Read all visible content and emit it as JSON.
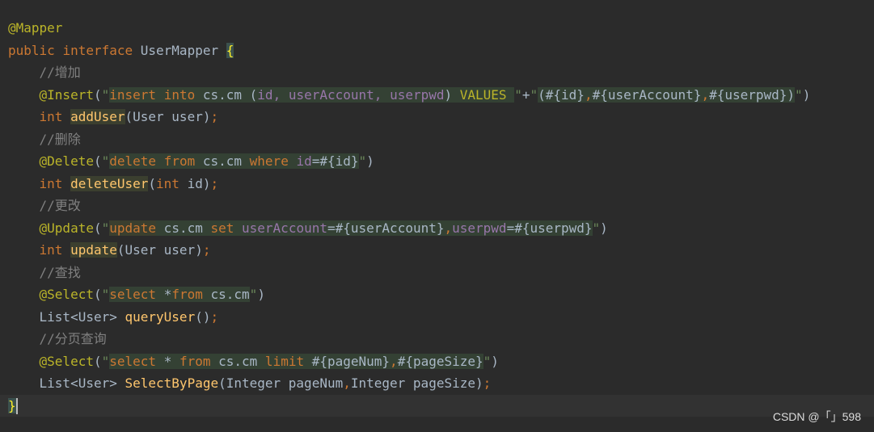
{
  "colors": {
    "background": "#2b2b2b",
    "annotation": "#bbb529",
    "keyword": "#cc7832",
    "string": "#6a8759",
    "sql_keyword": "#cc7832",
    "sql_column": "#9876aa",
    "method": "#ffc66d",
    "comment": "#808080",
    "default": "#a9b7c6"
  },
  "lines": [
    [
      {
        "t": "@Mapper",
        "c": "annotation"
      }
    ],
    [
      {
        "t": "public ",
        "c": "keyword"
      },
      {
        "t": "interface ",
        "c": "keyword"
      },
      {
        "t": "UserMapper ",
        "c": "default"
      },
      {
        "t": "{",
        "c": "brace"
      }
    ],
    [
      {
        "t": "    //增加",
        "c": "comment"
      }
    ],
    [
      {
        "t": "    ",
        "c": "default"
      },
      {
        "t": "@Insert",
        "c": "annotation"
      },
      {
        "t": "(",
        "c": "default"
      },
      {
        "t": "\"",
        "c": "string"
      },
      {
        "t": "insert ",
        "c": "sql_keyword",
        "h": 1
      },
      {
        "t": "into ",
        "c": "sql_keyword",
        "h": 1
      },
      {
        "t": "cs.cm ",
        "c": "default",
        "h": 1
      },
      {
        "t": "(",
        "c": "default",
        "h": 1
      },
      {
        "t": "id, ",
        "c": "sql_column",
        "h": 1
      },
      {
        "t": "userAccount, ",
        "c": "sql_column",
        "h": 1
      },
      {
        "t": "userpwd",
        "c": "sql_column",
        "h": 1
      },
      {
        "t": ") ",
        "c": "default",
        "h": 1
      },
      {
        "t": "VALUES ",
        "c": "annotation",
        "h": 1
      },
      {
        "t": "\"",
        "c": "string"
      },
      {
        "t": "+",
        "c": "default"
      },
      {
        "t": "\"",
        "c": "string"
      },
      {
        "t": "(",
        "c": "default",
        "h": 1
      },
      {
        "t": "#{id}",
        "c": "default",
        "h": 1
      },
      {
        "t": ",",
        "c": "keyword",
        "h": 1
      },
      {
        "t": "#{userAccount}",
        "c": "default",
        "h": 1
      },
      {
        "t": ",",
        "c": "keyword",
        "h": 1
      },
      {
        "t": "#{userpwd}",
        "c": "default",
        "h": 1
      },
      {
        "t": ")",
        "c": "default",
        "h": 1
      },
      {
        "t": "\"",
        "c": "string"
      },
      {
        "t": ")",
        "c": "default"
      }
    ],
    [
      {
        "t": "    ",
        "c": "default"
      },
      {
        "t": "int ",
        "c": "keyword"
      },
      {
        "t": "addUser",
        "c": "method",
        "b": 1
      },
      {
        "t": "(User user)",
        "c": "default"
      },
      {
        "t": ";",
        "c": "keyword"
      }
    ],
    [
      {
        "t": "    //删除",
        "c": "comment"
      }
    ],
    [
      {
        "t": "    ",
        "c": "default"
      },
      {
        "t": "@Delete",
        "c": "annotation"
      },
      {
        "t": "(",
        "c": "default"
      },
      {
        "t": "\"",
        "c": "string"
      },
      {
        "t": "delete ",
        "c": "sql_keyword",
        "h": 1
      },
      {
        "t": "from ",
        "c": "sql_keyword",
        "h": 1
      },
      {
        "t": "cs.cm ",
        "c": "default",
        "h": 1
      },
      {
        "t": "where ",
        "c": "sql_keyword",
        "h": 1
      },
      {
        "t": "id",
        "c": "sql_column",
        "h": 1
      },
      {
        "t": "=",
        "c": "default",
        "h": 1
      },
      {
        "t": "#{id}",
        "c": "default",
        "h": 1
      },
      {
        "t": "\"",
        "c": "string"
      },
      {
        "t": ")",
        "c": "default"
      }
    ],
    [
      {
        "t": "    ",
        "c": "default"
      },
      {
        "t": "int ",
        "c": "keyword"
      },
      {
        "t": "deleteUser",
        "c": "method",
        "b": 1
      },
      {
        "t": "(",
        "c": "default"
      },
      {
        "t": "int ",
        "c": "keyword"
      },
      {
        "t": "id)",
        "c": "default"
      },
      {
        "t": ";",
        "c": "keyword"
      }
    ],
    [
      {
        "t": "    //更改",
        "c": "comment"
      }
    ],
    [
      {
        "t": "    ",
        "c": "default"
      },
      {
        "t": "@Update",
        "c": "annotation"
      },
      {
        "t": "(",
        "c": "default"
      },
      {
        "t": "\"",
        "c": "string"
      },
      {
        "t": "update",
        "c": "sql_keyword",
        "b": 1
      },
      {
        "t": " cs.cm ",
        "c": "default",
        "h": 1
      },
      {
        "t": "set ",
        "c": "sql_keyword",
        "h": 1
      },
      {
        "t": "userAccount",
        "c": "sql_column",
        "h": 1
      },
      {
        "t": "=",
        "c": "default",
        "h": 1
      },
      {
        "t": "#{userAccount}",
        "c": "default",
        "h": 1
      },
      {
        "t": ",",
        "c": "keyword",
        "h": 1
      },
      {
        "t": "userpwd",
        "c": "sql_column",
        "h": 1
      },
      {
        "t": "=",
        "c": "default",
        "h": 1
      },
      {
        "t": "#{userpwd}",
        "c": "default",
        "h": 1
      },
      {
        "t": "\"",
        "c": "string"
      },
      {
        "t": ")",
        "c": "default"
      }
    ],
    [
      {
        "t": "    ",
        "c": "default"
      },
      {
        "t": "int ",
        "c": "keyword"
      },
      {
        "t": "update",
        "c": "method",
        "b": 1
      },
      {
        "t": "(User user)",
        "c": "default"
      },
      {
        "t": ";",
        "c": "keyword"
      }
    ],
    [
      {
        "t": "    //查找",
        "c": "comment"
      }
    ],
    [
      {
        "t": "    ",
        "c": "default"
      },
      {
        "t": "@Select",
        "c": "annotation"
      },
      {
        "t": "(",
        "c": "default"
      },
      {
        "t": "\"",
        "c": "string"
      },
      {
        "t": "select ",
        "c": "sql_keyword",
        "h": 1
      },
      {
        "t": "*",
        "c": "default",
        "h": 1
      },
      {
        "t": "from ",
        "c": "sql_keyword",
        "h": 1
      },
      {
        "t": "cs.cm",
        "c": "default",
        "h": 1
      },
      {
        "t": "\"",
        "c": "string"
      },
      {
        "t": ")",
        "c": "default"
      }
    ],
    [
      {
        "t": "    List<User> ",
        "c": "default"
      },
      {
        "t": "queryUser",
        "c": "method"
      },
      {
        "t": "()",
        "c": "default"
      },
      {
        "t": ";",
        "c": "keyword"
      }
    ],
    [
      {
        "t": "    //分页查询",
        "c": "comment"
      }
    ],
    [
      {
        "t": "    ",
        "c": "default"
      },
      {
        "t": "@Select",
        "c": "annotation"
      },
      {
        "t": "(",
        "c": "default"
      },
      {
        "t": "\"",
        "c": "string"
      },
      {
        "t": "select ",
        "c": "sql_keyword",
        "h": 1
      },
      {
        "t": "* ",
        "c": "default",
        "h": 1
      },
      {
        "t": "from ",
        "c": "sql_keyword",
        "h": 1
      },
      {
        "t": "cs.cm ",
        "c": "default",
        "h": 1
      },
      {
        "t": "limit ",
        "c": "sql_keyword",
        "h": 1
      },
      {
        "t": "#{pageNum}",
        "c": "default",
        "h": 1
      },
      {
        "t": ",",
        "c": "keyword",
        "h": 1
      },
      {
        "t": "#{pageSize}",
        "c": "default",
        "h": 1
      },
      {
        "t": "\"",
        "c": "string"
      },
      {
        "t": ")",
        "c": "default"
      }
    ],
    [
      {
        "t": "    List<User> ",
        "c": "default"
      },
      {
        "t": "SelectByPage",
        "c": "method"
      },
      {
        "t": "(Integer pageNum",
        "c": "default"
      },
      {
        "t": ",",
        "c": "keyword"
      },
      {
        "t": "Integer pageSize)",
        "c": "default"
      },
      {
        "t": ";",
        "c": "keyword"
      }
    ],
    [
      {
        "t": "}",
        "c": "brace",
        "caret": 1
      }
    ]
  ],
  "watermark": "CSDN @「」598"
}
